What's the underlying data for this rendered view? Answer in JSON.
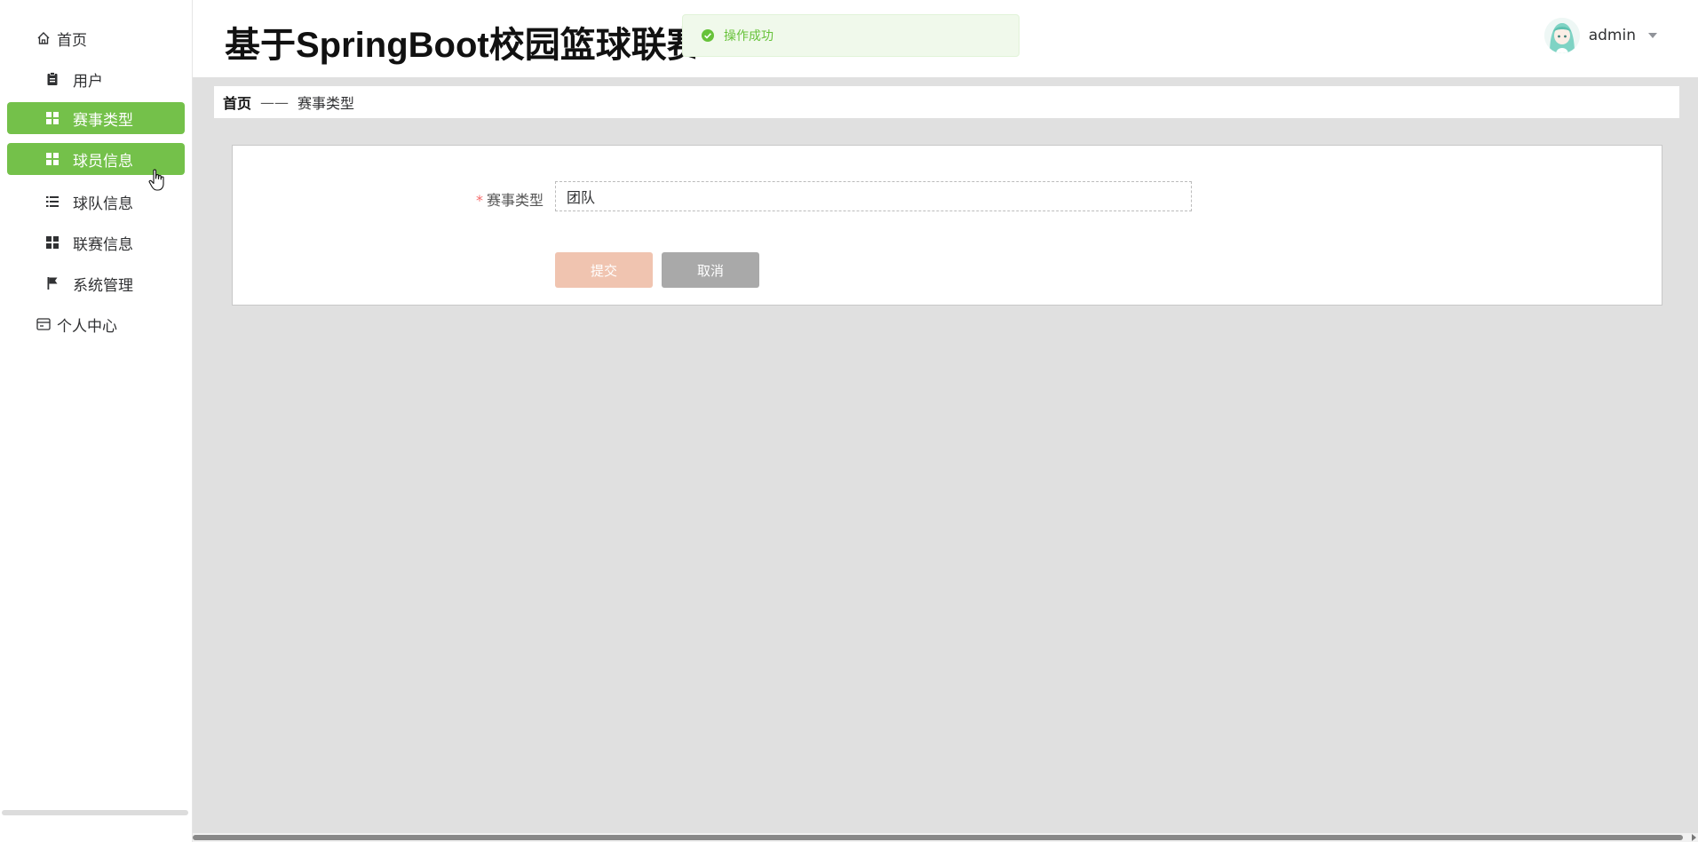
{
  "header": {
    "title": "基于SpringBoot校园篮球联赛信息管理系统",
    "toast": "操作成功",
    "username": "admin"
  },
  "sidebar": {
    "items": [
      {
        "label": "首页",
        "icon": "home-icon",
        "level": "top",
        "active": false
      },
      {
        "label": "用户",
        "icon": "clipboard-icon",
        "level": "sub",
        "active": false
      },
      {
        "label": "赛事类型",
        "icon": "grid-icon",
        "level": "sub",
        "active": true
      },
      {
        "label": "球员信息",
        "icon": "grid-icon",
        "level": "sub",
        "active": true
      },
      {
        "label": "球队信息",
        "icon": "list-icon",
        "level": "sub",
        "active": false
      },
      {
        "label": "联赛信息",
        "icon": "grid-icon",
        "level": "sub",
        "active": false
      },
      {
        "label": "系统管理",
        "icon": "flag-icon",
        "level": "sub",
        "active": false
      },
      {
        "label": "个人中心",
        "icon": "card-icon",
        "level": "top",
        "active": false
      }
    ]
  },
  "breadcrumb": {
    "home": "首页",
    "separator": "——",
    "current": "赛事类型"
  },
  "form": {
    "required_mark": "*",
    "label": "赛事类型",
    "value": "团队",
    "submit": "提交",
    "cancel": "取消"
  },
  "colors": {
    "accent": "#74c14a",
    "submit": "#f0c4b0",
    "cancel": "#a9a9a9",
    "main_bg": "#e0e0e0",
    "toast_bg": "#f0f9eb",
    "toast_text": "#67c23a"
  }
}
